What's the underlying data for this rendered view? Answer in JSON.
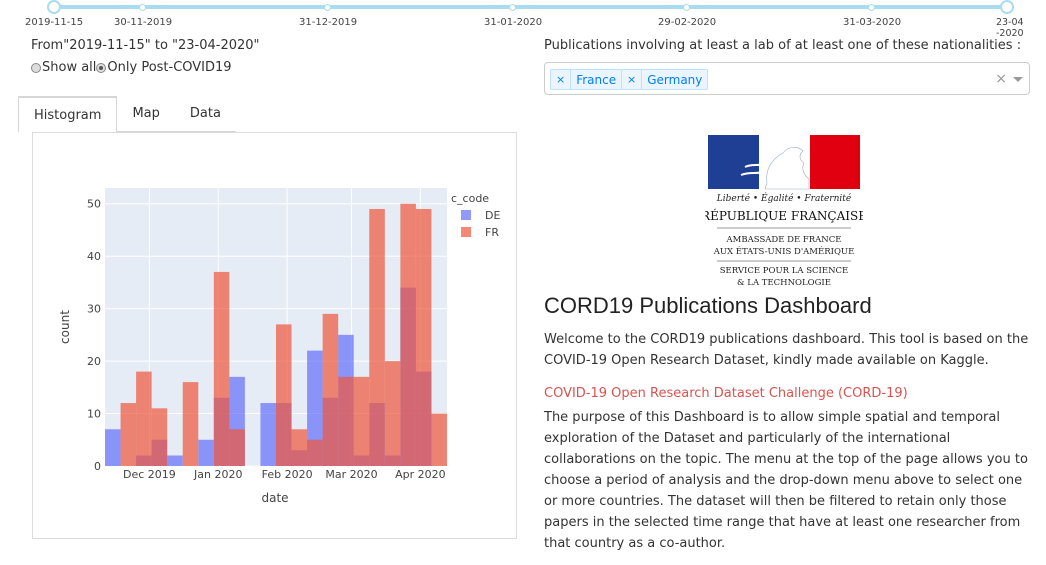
{
  "slider": {
    "marks": [
      "2019-11-15",
      "30-11-2019",
      "31-12-2019",
      "31-01-2020",
      "29-02-2020",
      "31-03-2020",
      "23-04-2020"
    ]
  },
  "range_text": "From\"2019-11-15\" to \"23-04-2020\"",
  "radios": {
    "options": [
      "Show all",
      "Only Post-COVID19"
    ],
    "selected": "Only Post-COVID19"
  },
  "nationalities": {
    "label": "Publications involving at least a lab of at least one of these nationalities :",
    "selected": [
      "France",
      "Germany"
    ],
    "clear_symbol": "×"
  },
  "tabs": [
    "Histogram",
    "Map",
    "Data"
  ],
  "active_tab": "Histogram",
  "chart_data": {
    "type": "bar",
    "barmode": "overlay",
    "xlabel": "date",
    "ylabel": "count",
    "x_ticks": [
      "Dec 2019",
      "Jan 2020",
      "Feb 2020",
      "Mar 2020",
      "Apr 2020"
    ],
    "y_ticks": [
      0,
      10,
      20,
      30,
      40,
      50
    ],
    "ylim": [
      0,
      53
    ],
    "legend_title": "c_code",
    "legend_position": "top-right",
    "grid": true,
    "bin_width_days": 7,
    "x_start": "2019-11-11",
    "series": [
      {
        "name": "DE",
        "color": "#636efa",
        "values": [
          7,
          0,
          2,
          5,
          2,
          0,
          5,
          13,
          17,
          0,
          12,
          12,
          3,
          22,
          13,
          25,
          2,
          12,
          2,
          34,
          18,
          0
        ]
      },
      {
        "name": "FR",
        "color": "#ef553b",
        "values": [
          0,
          12,
          18,
          11,
          0,
          16,
          0,
          37,
          7,
          0,
          0,
          27,
          7,
          5,
          29,
          17,
          17,
          49,
          20,
          50,
          49,
          10
        ]
      }
    ]
  },
  "title": "CORD19 Publications Dashboard",
  "intro": "Welcome to the CORD19 publications dashboard. This tool is based on the COVID-19 Open Research Dataset, kindly made available on Kaggle.",
  "link": "COVID-19 Open Research Dataset Challenge (CORD-19)",
  "description": "The purpose of this Dashboard is to allow simple spatial and temporal exploration of the Dataset and particularly of the international collaborations on the topic. The menu at the top of the page allows you to choose a period of analysis and the drop-down menu above to select one or more countries. The dataset will then be filtered to retain only those papers in the selected time range that have at least one researcher from that country as a co-author.",
  "logo": {
    "motto": "Liberté • Égalité • Fraternité",
    "republic": "RÉPUBLIQUE FRANÇAISE",
    "line1": "AMBASSADE DE FRANCE",
    "line2": "AUX ÉTATS-UNIS D'AMÉRIQUE",
    "line3": "SERVICE POUR LA SCIENCE",
    "line4": "& LA TECHNOLOGIE"
  }
}
